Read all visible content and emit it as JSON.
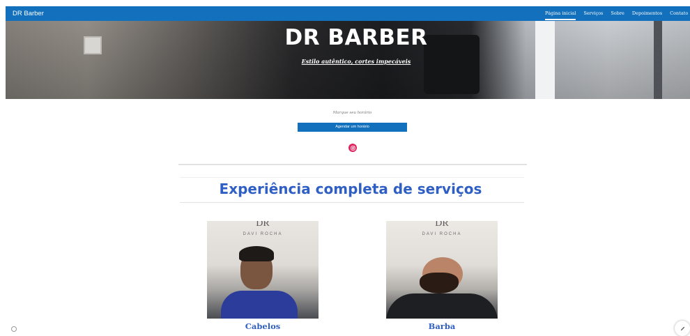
{
  "header": {
    "brand": "DR Barber",
    "nav": [
      {
        "label": "Página inicial",
        "active": true
      },
      {
        "label": "Serviços",
        "active": false
      },
      {
        "label": "Sobre",
        "active": false
      },
      {
        "label": "Depoimentos",
        "active": false
      },
      {
        "label": "Contato",
        "active": false
      }
    ]
  },
  "hero": {
    "title": "DR BARBER",
    "subtitle": "Estilo autêntico, cortes impecáveis"
  },
  "booking": {
    "label": "Marque seu horário",
    "button_label": "Agendar um horário",
    "social_icon": "instagram-icon"
  },
  "services": {
    "section_title": "Experiência completa de serviços",
    "watermark_initials": "DR",
    "watermark_name": "DAVI ROCHA",
    "cards": [
      {
        "label": "Cabelos"
      },
      {
        "label": "Barba"
      }
    ]
  },
  "colors": {
    "primary": "#1270bd",
    "heading": "#2f5fc4",
    "instagram": "#e0245e"
  }
}
